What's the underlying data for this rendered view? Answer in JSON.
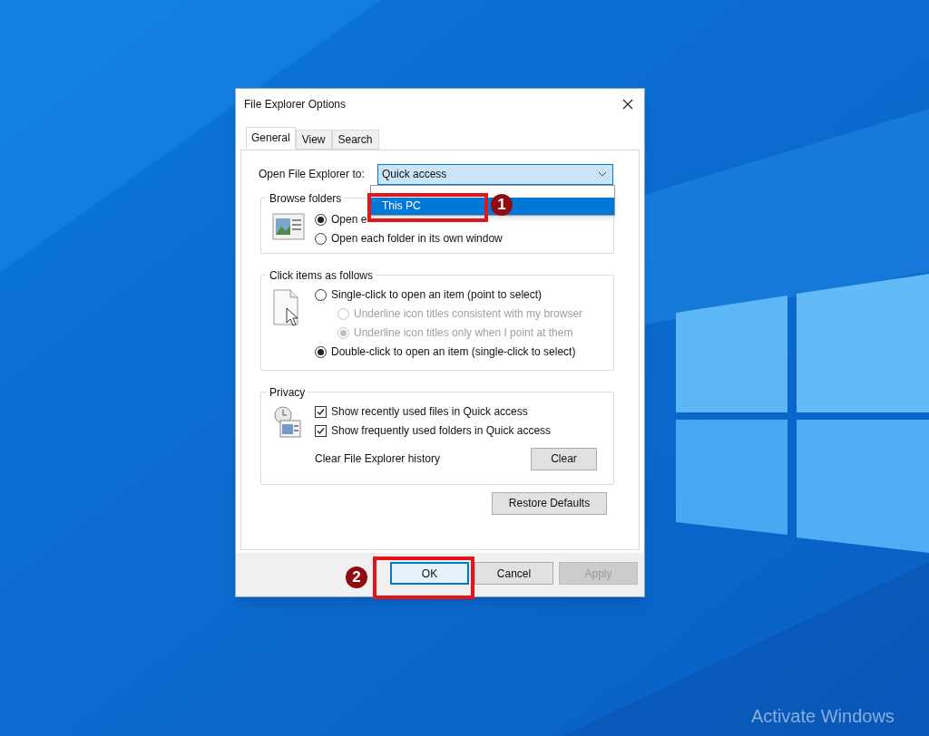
{
  "desktop": {
    "activation_notice": "Activate Windows"
  },
  "window": {
    "title": "File Explorer Options"
  },
  "tabs": [
    {
      "label": "General",
      "selected": true
    },
    {
      "label": "View",
      "selected": false
    },
    {
      "label": "Search",
      "selected": false
    }
  ],
  "open_to": {
    "label": "Open File Explorer to:",
    "value": "Quick access",
    "expanded": true,
    "options": [
      {
        "label": "This PC",
        "selected": true
      }
    ]
  },
  "groups": [
    {
      "title": "Browse folders",
      "kind": "browse",
      "items": [
        {
          "kind": "radio",
          "label": "Open e",
          "checked": true,
          "disabled": false
        },
        {
          "kind": "radio",
          "label": "Open each folder in its own window",
          "checked": false,
          "disabled": false
        }
      ]
    },
    {
      "title": "Click items as follows",
      "kind": "click",
      "items": [
        {
          "kind": "radio",
          "label": "Single-click to open an item (point to select)",
          "checked": false,
          "disabled": false,
          "children": [
            {
              "kind": "radio",
              "label": "Underline icon titles consistent with my browser",
              "checked": false,
              "disabled": true
            },
            {
              "kind": "radio",
              "label": "Underline icon titles only when I point at them",
              "checked": true,
              "disabled": true
            }
          ]
        },
        {
          "kind": "radio",
          "label": "Double-click to open an item (single-click to select)",
          "checked": true,
          "disabled": false
        }
      ]
    },
    {
      "title": "Privacy",
      "kind": "privacy",
      "items": [
        {
          "kind": "checkbox",
          "label": "Show recently used files in Quick access",
          "checked": true,
          "disabled": false
        },
        {
          "kind": "checkbox",
          "label": "Show frequently used folders in Quick access",
          "checked": true,
          "disabled": false
        }
      ],
      "history": {
        "label": "Clear File Explorer history",
        "button": "Clear"
      }
    }
  ],
  "restore_button": "Restore Defaults",
  "buttons": [
    {
      "label": "OK",
      "focused": true,
      "disabled": false
    },
    {
      "label": "Cancel",
      "focused": false,
      "disabled": false
    },
    {
      "label": "Apply",
      "focused": false,
      "disabled": true
    }
  ],
  "annotations": [
    {
      "number": "1"
    },
    {
      "number": "2"
    }
  ]
}
